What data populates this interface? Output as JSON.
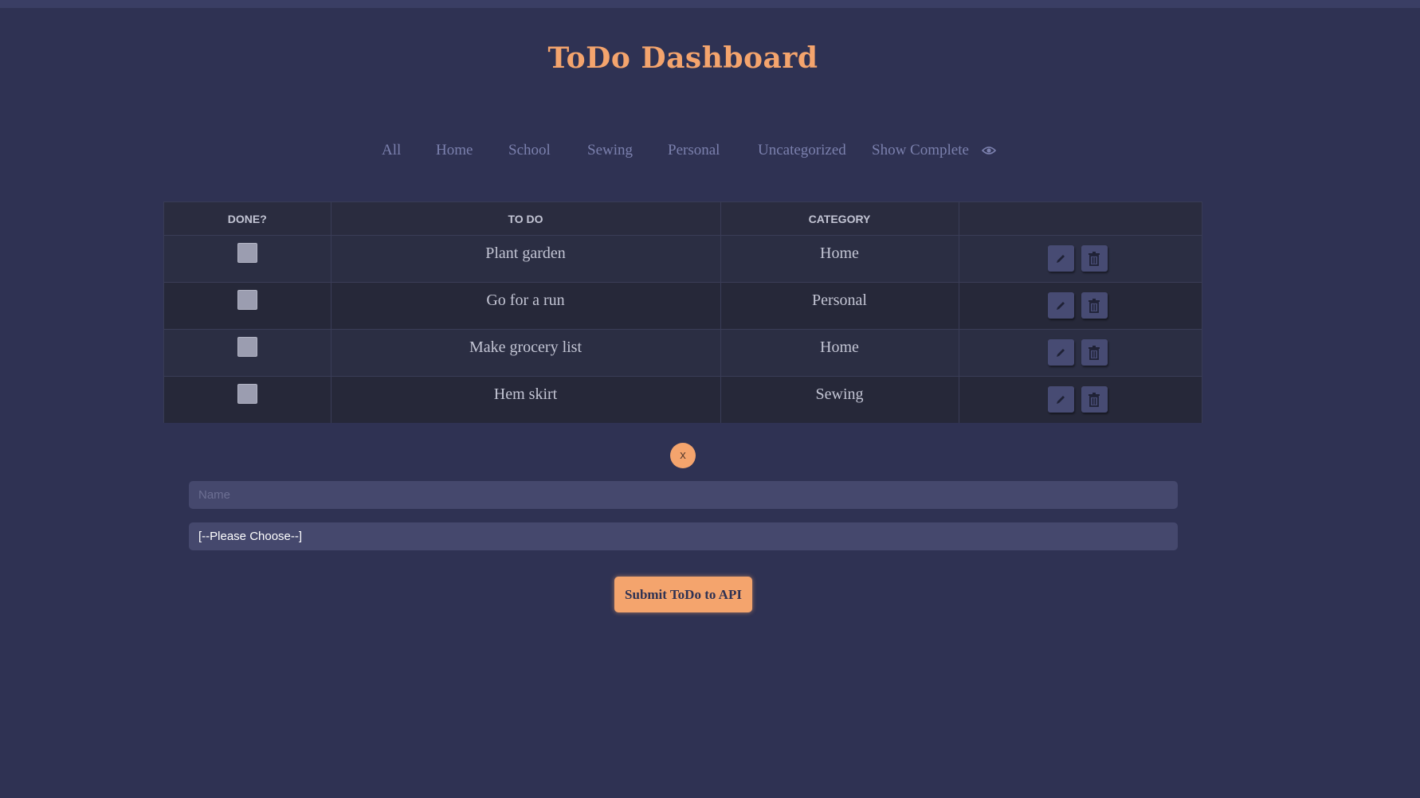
{
  "header": {
    "title": "ToDo Dashboard"
  },
  "filters": [
    {
      "label": "All"
    },
    {
      "label": "Home"
    },
    {
      "label": "School"
    },
    {
      "label": "Sewing"
    },
    {
      "label": "Personal"
    },
    {
      "label": "Uncategorized"
    }
  ],
  "show_complete": {
    "label": "Show Complete",
    "icon": "eye-icon"
  },
  "table": {
    "headers": [
      "DONE?",
      "TO DO",
      "CATEGORY",
      ""
    ],
    "rows": [
      {
        "done": false,
        "todo": "Plant garden",
        "category": "Home"
      },
      {
        "done": false,
        "todo": "Go for a run",
        "category": "Personal"
      },
      {
        "done": false,
        "todo": "Make grocery list",
        "category": "Home"
      },
      {
        "done": false,
        "todo": "Hem skirt",
        "category": "Sewing"
      }
    ]
  },
  "form": {
    "close_label": "x",
    "name_placeholder": "Name",
    "category_selected": "[--Please Choose--]",
    "submit_label": "Submit ToDo to API"
  },
  "colors": {
    "background": "#2f3253",
    "accent": "#f4a46d",
    "link": "#7b80ad",
    "field": "#45486d"
  }
}
